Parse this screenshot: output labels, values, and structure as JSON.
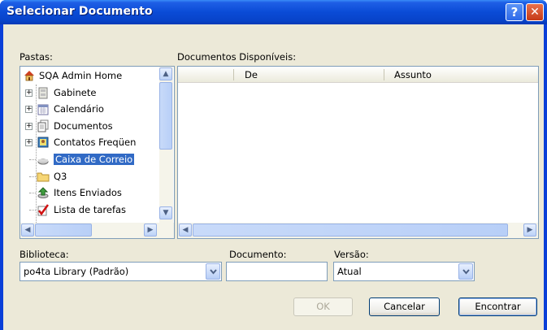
{
  "window": {
    "title": "Selecionar Documento",
    "help_glyph": "?",
    "close_glyph": "✕"
  },
  "folders": {
    "label": "Pastas:",
    "items": [
      {
        "label": "SQA Admin Home",
        "icon": "home-icon",
        "expandable": false,
        "selected": false
      },
      {
        "label": "Gabinete",
        "icon": "cabinet-icon",
        "expandable": true,
        "selected": false
      },
      {
        "label": "Calendário",
        "icon": "calendar-icon",
        "expandable": true,
        "selected": false
      },
      {
        "label": "Documentos",
        "icon": "documents-icon",
        "expandable": true,
        "selected": false
      },
      {
        "label": "Contatos Freqüen",
        "icon": "contacts-icon",
        "expandable": true,
        "selected": false
      },
      {
        "label": "Caixa de Correio",
        "icon": "mailbox-icon",
        "expandable": false,
        "selected": true
      },
      {
        "label": "Q3",
        "icon": "folder-icon",
        "expandable": false,
        "selected": false
      },
      {
        "label": "Itens Enviados",
        "icon": "sent-items-icon",
        "expandable": false,
        "selected": false
      },
      {
        "label": "Lista de tarefas",
        "icon": "checklist-icon",
        "expandable": false,
        "selected": false
      }
    ]
  },
  "documents": {
    "label": "Documentos Disponíveis:",
    "columns": [
      "De",
      "Assunto"
    ]
  },
  "library": {
    "label": "Biblioteca:",
    "value": "po4ta Library  (Padrão)"
  },
  "document": {
    "label": "Documento:",
    "value": ""
  },
  "version": {
    "label": "Versão:",
    "value": "Atual"
  },
  "buttons": {
    "ok": "OK",
    "cancel": "Cancelar",
    "find": "Encontrar"
  },
  "colors": {
    "titlebar": "#0a4bd6",
    "dialog_bg": "#ece9d8",
    "selection": "#316ac5"
  }
}
